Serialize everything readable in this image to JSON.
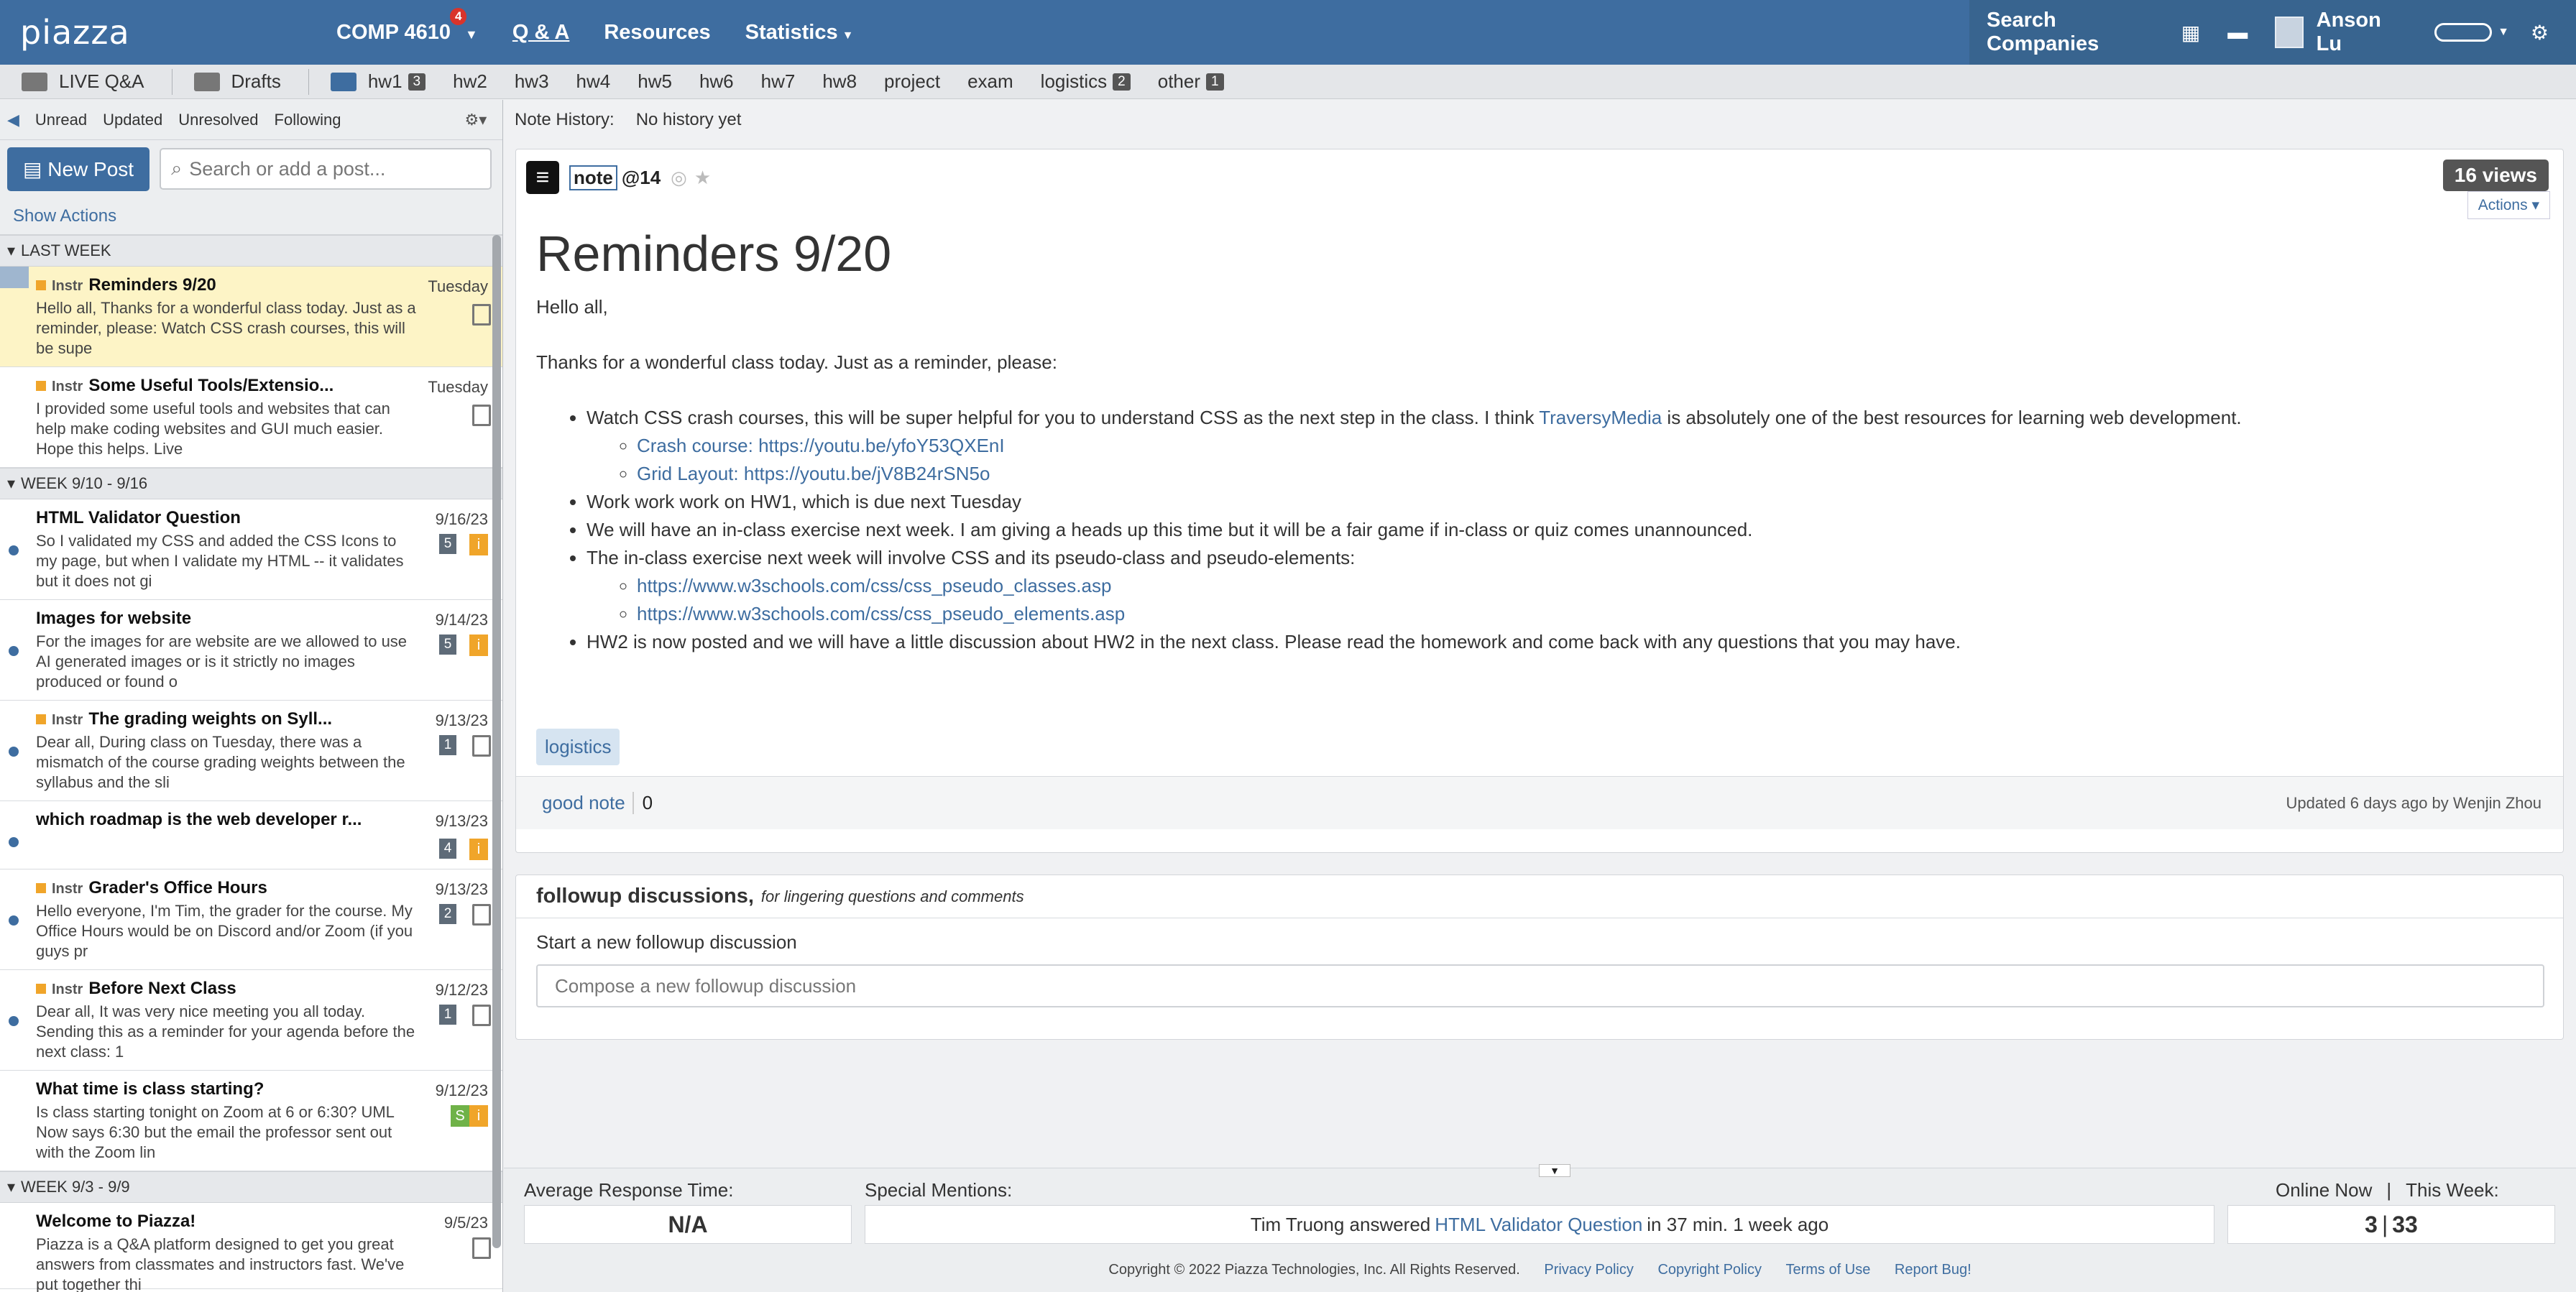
{
  "topbar": {
    "logo": "piazza",
    "course": "COMP 4610",
    "course_badge": "4",
    "nav": [
      "Q & A",
      "Resources",
      "Statistics"
    ],
    "search_companies": "Search Companies",
    "user": "Anson Lu"
  },
  "folders": {
    "live": "LIVE Q&A",
    "drafts": "Drafts",
    "items": [
      {
        "label": "hw1",
        "count": "3"
      },
      {
        "label": "hw2"
      },
      {
        "label": "hw3"
      },
      {
        "label": "hw4"
      },
      {
        "label": "hw5"
      },
      {
        "label": "hw6"
      },
      {
        "label": "hw7"
      },
      {
        "label": "hw8"
      },
      {
        "label": "project"
      },
      {
        "label": "exam"
      },
      {
        "label": "logistics",
        "count": "2"
      },
      {
        "label": "other",
        "count": "1"
      }
    ]
  },
  "filters": [
    "Unread",
    "Updated",
    "Unresolved",
    "Following"
  ],
  "new_post": "New Post",
  "search_placeholder": "Search or add a post...",
  "show_actions": "Show Actions",
  "groups": {
    "g1": "LAST WEEK",
    "g2": "WEEK 9/10 - 9/16",
    "g3": "WEEK 9/3 - 9/9"
  },
  "posts": [
    {
      "instr": "Instr",
      "title": "Reminders 9/20",
      "date": "Tuesday",
      "body": "Hello all,  Thanks for a wonderful class today. Just as a reminder, please: Watch CSS crash courses, this will be supe"
    },
    {
      "instr": "Instr",
      "title": "Some Useful Tools/Extensio...",
      "date": "Tuesday",
      "body": "I provided some useful tools and websites that can help make coding websites and GUI much easier. Hope this helps. Live"
    },
    {
      "title": "HTML Validator Question",
      "date": "9/16/23",
      "count": "5",
      "body": "So I validated my CSS and added the CSS Icons to my page, but when I validate my HTML -- it validates but it does not gi"
    },
    {
      "title": "Images for website",
      "date": "9/14/23",
      "count": "5",
      "body": "For the images for are website are we allowed to use AI generated images or is it strictly no images produced or found o"
    },
    {
      "instr": "Instr",
      "title": "The grading weights on Syll...",
      "date": "9/13/23",
      "count": "1",
      "body": "Dear all,  During class on Tuesday, there was a mismatch of the course grading weights between the syllabus and the sli"
    },
    {
      "title": "which roadmap is the web developer r...",
      "date": "9/13/23",
      "count": "4",
      "body": ""
    },
    {
      "instr": "Instr",
      "title": "Grader's Office Hours",
      "date": "9/13/23",
      "count": "2",
      "body": "Hello everyone, I'm Tim, the grader for the course. My Office Hours would be on Discord and/or Zoom (if you guys pr"
    },
    {
      "instr": "Instr",
      "title": "Before Next Class",
      "date": "9/12/23",
      "count": "1",
      "body": "Dear all,  It was very nice meeting you all today. Sending this as a reminder for your agenda before the next class: 1"
    },
    {
      "title": "What time is class starting?",
      "date": "9/12/23",
      "body": "Is class starting tonight on Zoom at 6 or 6:30? UML Now says 6:30 but the email the professor sent out with the Zoom lin"
    },
    {
      "title": "Welcome to Piazza!",
      "date": "9/5/23",
      "body": "Piazza is a Q&A platform designed to get you great answers from classmates and instructors fast. We've put together thi"
    }
  ],
  "badges": {
    "i": "i",
    "s": "S"
  },
  "note": {
    "history_label": "Note History:",
    "history_value": "No history yet",
    "type": "note",
    "number": "@14",
    "views": "16 views",
    "actions": "Actions",
    "title": "Reminders 9/20",
    "greeting": "Hello all,",
    "intro": "Thanks for a wonderful class today. Just as a reminder, please:",
    "b1a": "Watch CSS crash courses, this will be super helpful for you to understand CSS as the next step in the class. I think ",
    "b1link": "TraversyMedia",
    "b1b": " is absolutely one of the best resources for learning web development.",
    "s1": "Crash course: https://youtu.be/yfoY53QXEnI",
    "s2": "Grid Layout: https://youtu.be/jV8B24rSN5o",
    "b2": "Work work work on HW1, which is due next Tuesday",
    "b3": "We will have an in-class exercise next week. I am giving a heads up this time but it will be a fair game if in-class or quiz comes unannounced.",
    "b4": "The in-class exercise next week will involve CSS and its pseudo-class and pseudo-elements:",
    "s3": "https://www.w3schools.com/css/css_pseudo_classes.asp",
    "s4": "https://www.w3schools.com/css/css_pseudo_elements.asp",
    "b5": "HW2 is now posted and we will have a little discussion about HW2 in the next class. Please read the homework and come back with any questions that you may have.",
    "tag": "logistics",
    "good_note": "good note",
    "good_count": "0",
    "updated": "Updated 6 days ago by Wenjin Zhou"
  },
  "followup": {
    "title": "followup discussions,",
    "subtitle": "for lingering questions and comments",
    "start": "Start a new followup discussion",
    "compose": "Compose a new followup discussion"
  },
  "stats": {
    "avg_label": "Average Response Time:",
    "avg_value": "N/A",
    "mentions_label": "Special Mentions:",
    "mention_a": "Tim Truong answered ",
    "mention_link": "HTML Validator Question",
    "mention_b": " in 37 min. 1 week ago",
    "online_label": "Online Now",
    "week_label": "This Week:",
    "online": "3",
    "week": "33"
  },
  "footer": {
    "copyright": "Copyright © 2022 Piazza Technologies, Inc. All Rights Reserved.",
    "links": [
      "Privacy Policy",
      "Copyright Policy",
      "Terms of Use",
      "Report Bug!"
    ]
  }
}
